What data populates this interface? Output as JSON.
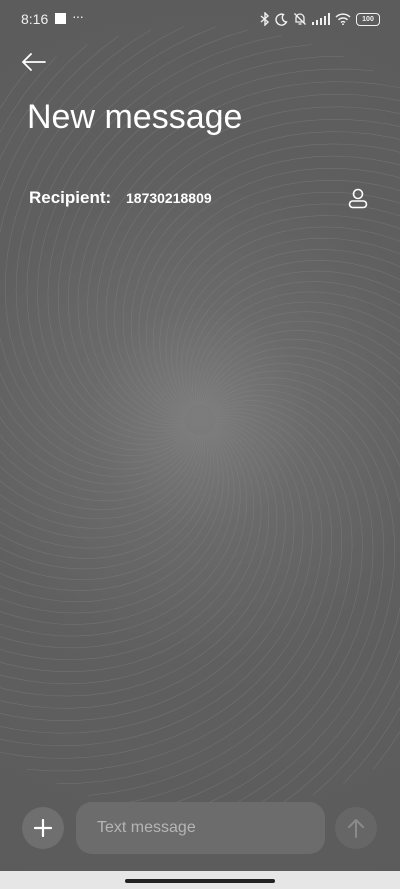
{
  "status_bar": {
    "time": "8:16",
    "more": "···",
    "battery": "100"
  },
  "header": {
    "title": "New message"
  },
  "recipient": {
    "label": "Recipient:",
    "value": "18730218809"
  },
  "compose": {
    "placeholder": "Text message"
  },
  "icons": {
    "back": "arrow-left-icon",
    "contact": "person-icon",
    "add": "plus-icon",
    "send": "arrow-up-icon"
  },
  "colors": {
    "background": "#5e5e5e",
    "input_background": "#6c6c6c",
    "text": "#ffffff",
    "placeholder": "#b5b5b5"
  }
}
